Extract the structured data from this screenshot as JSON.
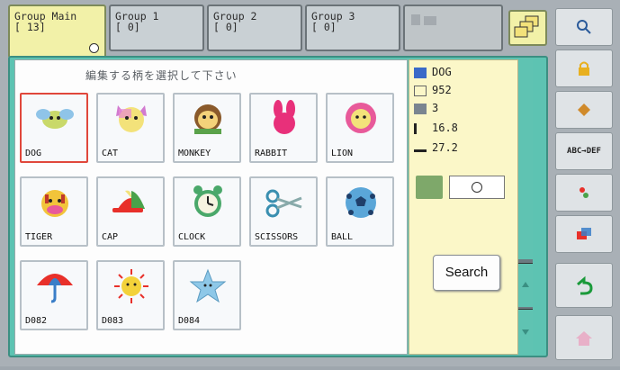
{
  "tabs": [
    {
      "label": "Group Main",
      "count": "[ 13]"
    },
    {
      "label": "Group 1",
      "count": "[  0]"
    },
    {
      "label": "Group 2",
      "count": "[  0]"
    },
    {
      "label": "Group 3",
      "count": "[  0]"
    }
  ],
  "prompt": "編集する柄を選択して下さい",
  "patterns": [
    {
      "name": "DOG"
    },
    {
      "name": "CAT"
    },
    {
      "name": "MONKEY"
    },
    {
      "name": "RABBIT"
    },
    {
      "name": "LION"
    },
    {
      "name": "TIGER"
    },
    {
      "name": "CAP"
    },
    {
      "name": "CLOCK"
    },
    {
      "name": "SCISSORS"
    },
    {
      "name": "BALL"
    },
    {
      "name": "D082"
    },
    {
      "name": "D083"
    },
    {
      "name": "D084"
    }
  ],
  "info": {
    "name": "DOG",
    "stitches": "952",
    "colors": "3",
    "height": "16.8",
    "width": "27.2"
  },
  "search_label": "Search",
  "toolbar": {
    "abc_def_label": "ABC→DEF"
  },
  "colors": {
    "accent": "#5dc3b2",
    "selected": "#e0473b",
    "tab_active": "#f2f1a8"
  }
}
